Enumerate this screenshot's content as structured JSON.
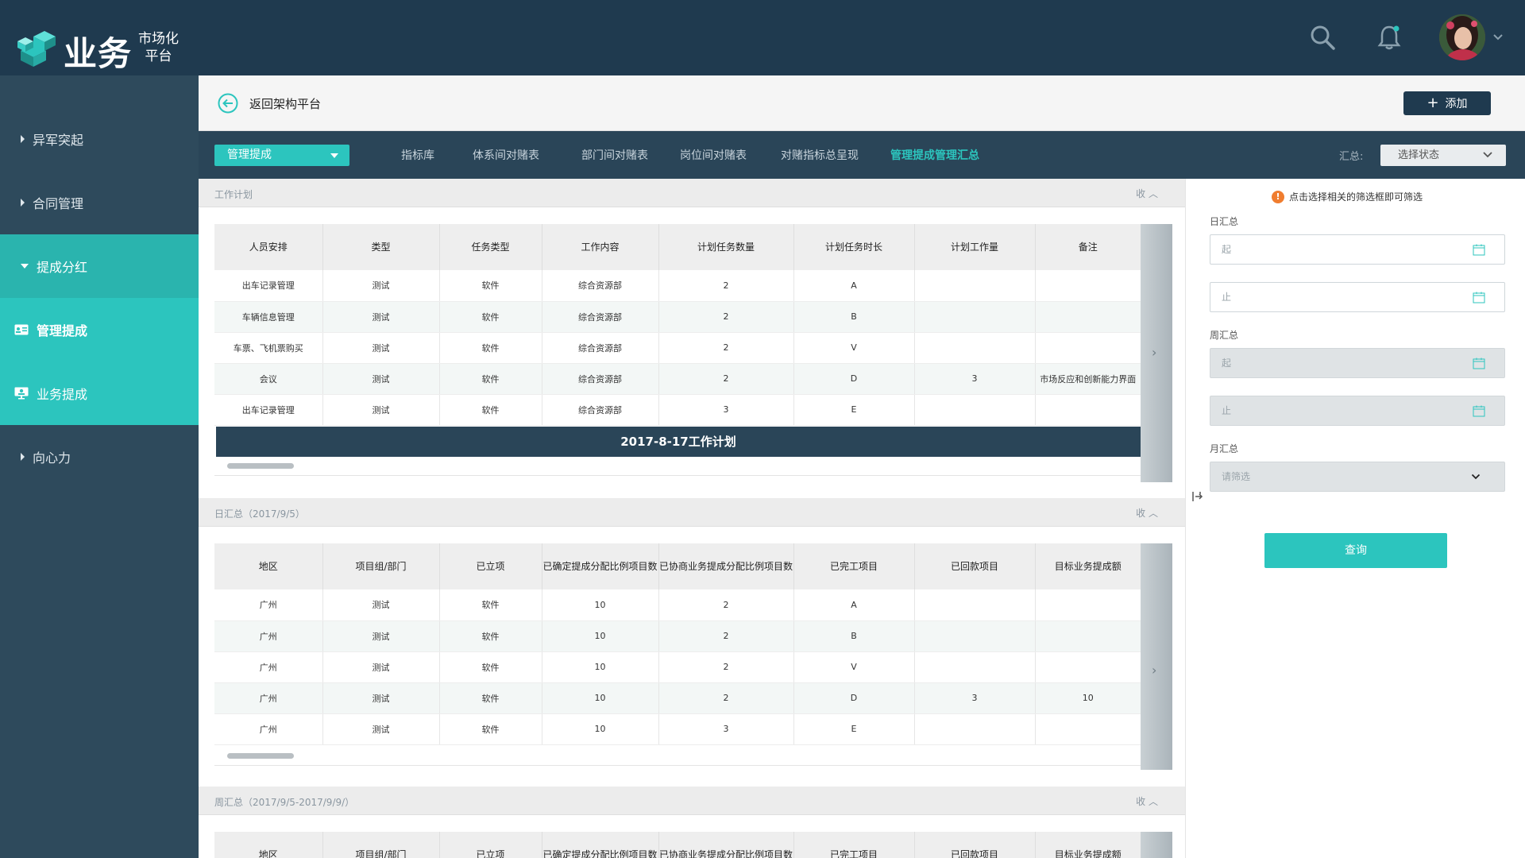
{
  "brand": {
    "main": "业务",
    "sub_line1": "市场化",
    "sub_line2": "平台"
  },
  "header": {
    "search_icon": "search-icon",
    "bell_icon": "bell-icon",
    "avatar_alt": "用户头像"
  },
  "sidebar": {
    "items": [
      {
        "label": "异军突起"
      },
      {
        "label": "合同管理"
      },
      {
        "label": "提成分红"
      },
      {
        "label": "向心力"
      }
    ],
    "sub_items": [
      {
        "label": "管理提成"
      },
      {
        "label": "业务提成"
      }
    ]
  },
  "subheader": {
    "back_label": "返回架构平台",
    "add_label": "添加"
  },
  "tabbar": {
    "select_value": "管理提成",
    "tabs": [
      {
        "label": "指标库"
      },
      {
        "label": "体系间对赌表"
      },
      {
        "label": "部门间对赌表"
      },
      {
        "label": "岗位间对赌表"
      },
      {
        "label": "对赌指标总呈现"
      },
      {
        "label": "管理提成管理汇总"
      }
    ],
    "summary_label": "汇总:",
    "state_placeholder": "选择状态"
  },
  "sections": {
    "plan": {
      "title": "工作计划",
      "collapse": "收",
      "headers": [
        "人员安排",
        "类型",
        "任务类型",
        "工作内容",
        "计划任务数量",
        "计划任务时长",
        "计划工作量",
        "备注"
      ],
      "rows": [
        [
          "出车记录管理",
          "测试",
          "软件",
          "综合资源部",
          "2",
          "A",
          "",
          ""
        ],
        [
          "车辆信息管理",
          "测试",
          "软件",
          "综合资源部",
          "2",
          "B",
          "",
          ""
        ],
        [
          "车票、飞机票购买",
          "测试",
          "软件",
          "综合资源部",
          "2",
          "V",
          "",
          ""
        ],
        [
          "会议",
          "测试",
          "软件",
          "综合资源部",
          "2",
          "D",
          "3",
          "市场反应和创新能力界面"
        ],
        [
          "出车记录管理",
          "测试",
          "软件",
          "综合资源部",
          "3",
          "E",
          "",
          ""
        ]
      ],
      "banner": "2017-8-17工作计划"
    },
    "daily": {
      "title": "日汇总（2017/9/5）",
      "collapse": "收",
      "headers": [
        "地区",
        "项目组/部门",
        "已立项",
        "已确定提成分配比例项目数",
        "已协商业务提成分配比例项目数",
        "已完工项目",
        "已回款项目",
        "目标业务提成额"
      ],
      "rows": [
        [
          "广州",
          "测试",
          "软件",
          "10",
          "2",
          "A",
          "",
          ""
        ],
        [
          "广州",
          "测试",
          "软件",
          "10",
          "2",
          "B",
          "",
          ""
        ],
        [
          "广州",
          "测试",
          "软件",
          "10",
          "2",
          "V",
          "",
          ""
        ],
        [
          "广州",
          "测试",
          "软件",
          "10",
          "2",
          "D",
          "3",
          "10"
        ],
        [
          "广州",
          "测试",
          "软件",
          "10",
          "3",
          "E",
          "",
          ""
        ]
      ]
    },
    "weekly": {
      "title": "周汇总（2017/9/5-2017/9/9/）",
      "collapse": "收",
      "headers": [
        "地区",
        "项目组/部门",
        "已立项",
        "已确定提成分配比例项目数",
        "已协商业务提成分配比例项目数",
        "已完工项目",
        "已回款项目",
        "目标业务提成额"
      ]
    }
  },
  "filter": {
    "hint": "点击选择相关的筛选框即可筛选",
    "day_label": "日汇总",
    "day_start": "起",
    "day_end": "止",
    "week_label": "周汇总",
    "week_start": "起",
    "week_end": "止",
    "month_label": "月汇总",
    "month_placeholder": "请筛选",
    "query_label": "查询"
  },
  "colors": {
    "header": "#1f3a4f",
    "sidebar": "#2e4a5c",
    "accent": "#2cc5be",
    "tabbar": "#2a4558"
  }
}
